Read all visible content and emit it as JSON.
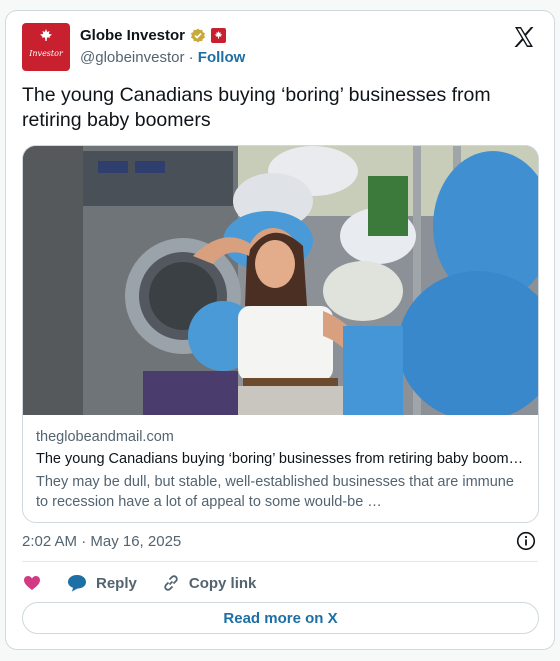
{
  "account": {
    "display_name": "Globe Investor",
    "handle": "@globeinvestor",
    "separator": "·",
    "follow_label": "Follow",
    "avatar_text": "Investor",
    "verified_color": "#c9a93b",
    "avatar_color": "#c8202f"
  },
  "tweet": {
    "text": "The young Canadians buying ‘boring’ businesses from retiring baby boomers",
    "timestamp": "2:02 AM · May 16, 2025"
  },
  "link_card": {
    "domain": "theglobeandmail.com",
    "title": "The young Canadians buying ‘boring’ businesses from retiring baby boomers",
    "description": "They may be dull, but stable, well-established businesses that are immune to recession have a lot of appeal to some would-be …",
    "image_alt": "Woman lying on laundry bags in front of laundromat washing machines"
  },
  "actions": {
    "reply_label": "Reply",
    "copy_link_label": "Copy link",
    "read_more_label": "Read more on X"
  },
  "icons": [
    "maple-leaf-icon",
    "verified-icon",
    "flag-icon",
    "x-logo-icon",
    "info-icon",
    "heart-icon",
    "reply-bubble-icon",
    "link-icon"
  ]
}
